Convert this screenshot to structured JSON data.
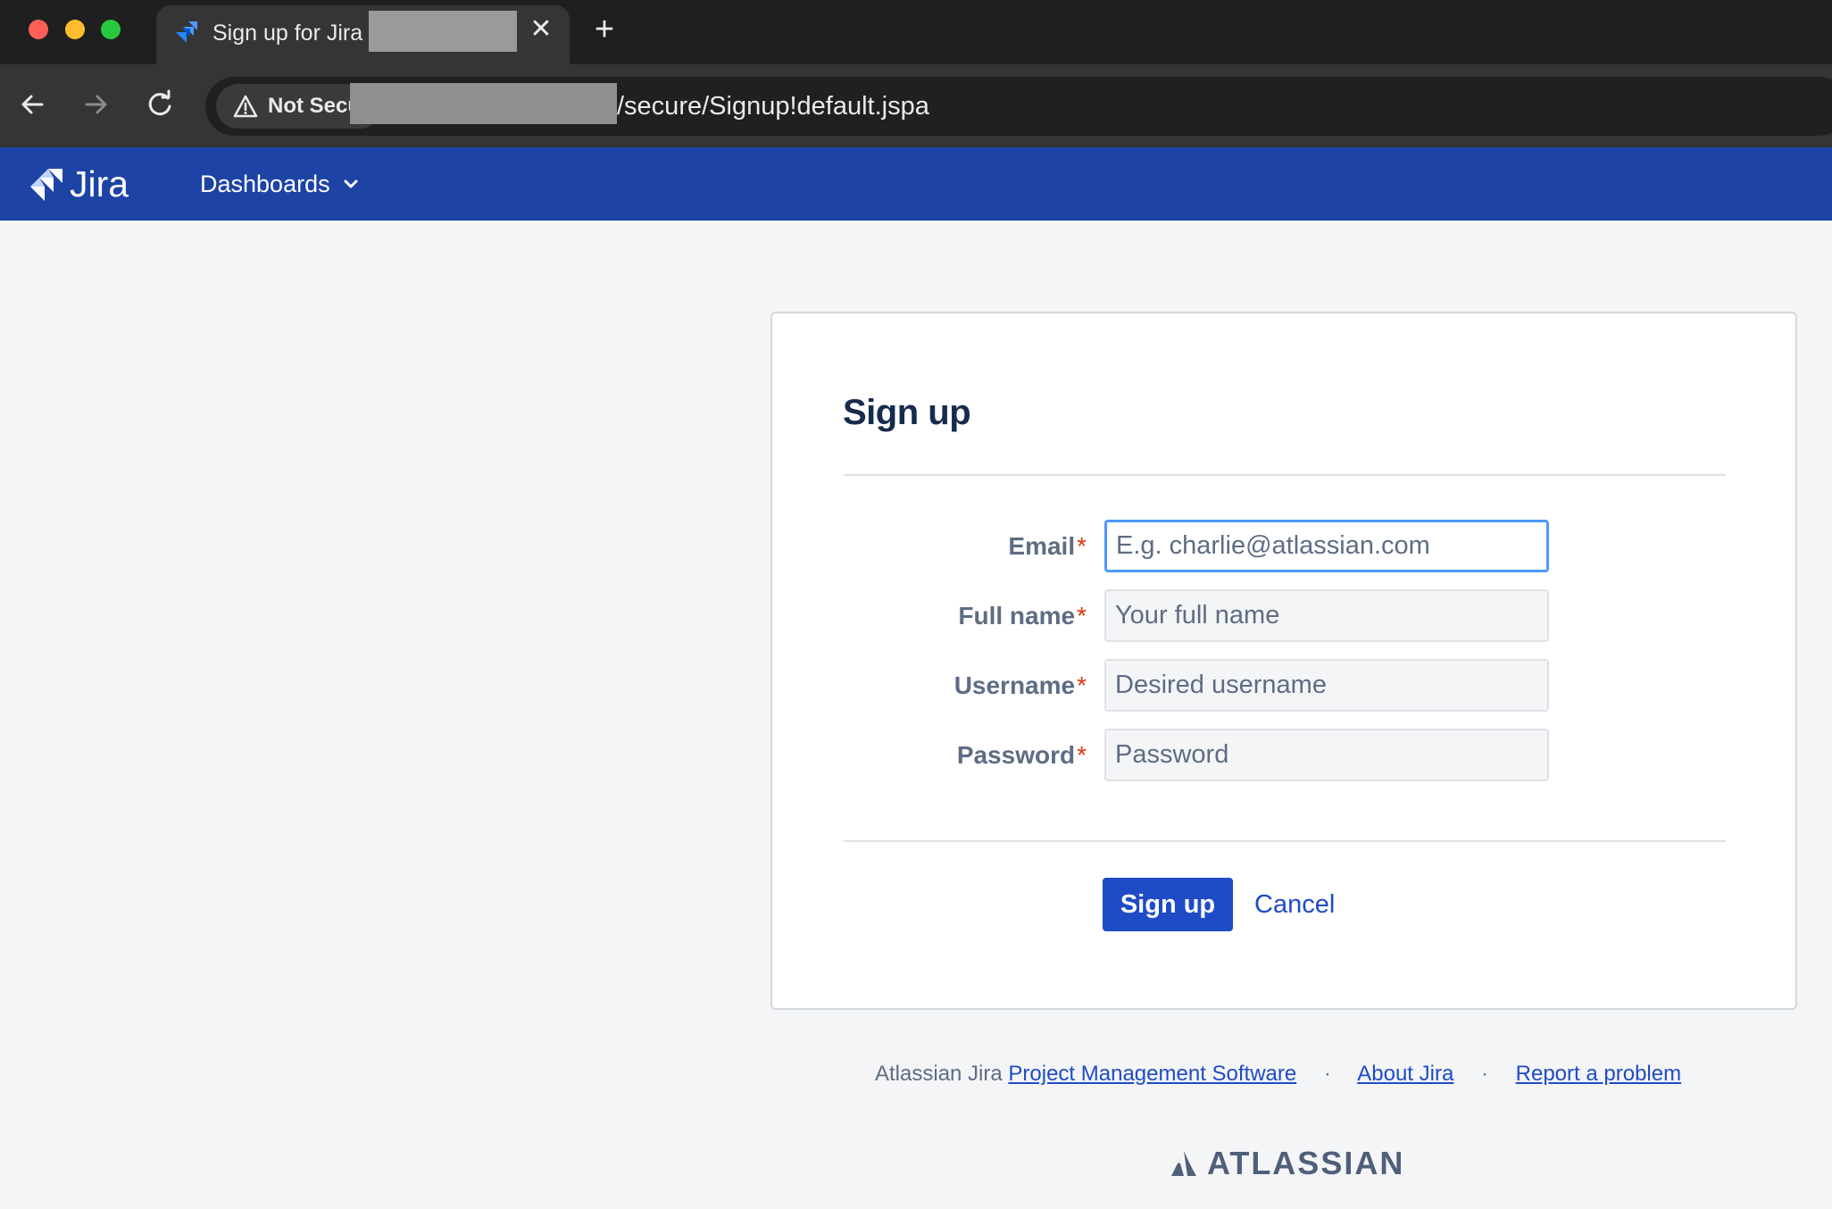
{
  "browser": {
    "tab_title": "Sign up for Jira",
    "close_tab_symbol": "✕",
    "new_tab_symbol": "+",
    "security_label": "Not Secu",
    "url_path": "/secure/Signup!default.jspa"
  },
  "header": {
    "app_name": "Jira",
    "nav_dashboards": "Dashboards"
  },
  "form": {
    "title": "Sign up",
    "fields": [
      {
        "label": "Email",
        "placeholder": "E.g. charlie@atlassian.com",
        "required": "*"
      },
      {
        "label": "Full name",
        "placeholder": "Your full name",
        "required": "*"
      },
      {
        "label": "Username",
        "placeholder": "Desired username",
        "required": "*"
      },
      {
        "label": "Password",
        "placeholder": "Password",
        "required": "*"
      }
    ],
    "submit_label": "Sign up",
    "cancel_label": "Cancel"
  },
  "footer": {
    "prefix": "Atlassian Jira",
    "link_pm": "Project Management Software",
    "separator": "·",
    "link_about": "About Jira",
    "link_report": "Report a problem",
    "brand": "ATLASSIAN"
  },
  "colors": {
    "jira_header": "#1d43a5",
    "primary_button": "#1f4bc7",
    "required_marker": "#de350b",
    "focus_border": "#4c9aff"
  },
  "icons": [
    "back-arrow-icon",
    "forward-arrow-icon",
    "reload-icon",
    "warning-triangle-icon",
    "jira-logo-icon",
    "chevron-down-icon",
    "atlassian-logo-icon",
    "close-icon",
    "plus-icon"
  ]
}
